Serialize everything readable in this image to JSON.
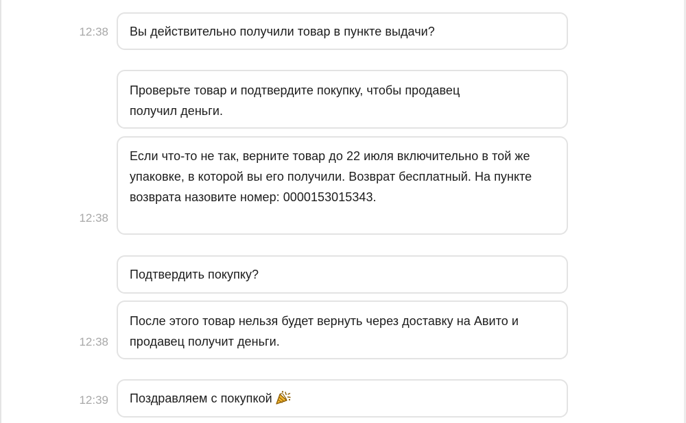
{
  "chat": {
    "messages": [
      {
        "time": "12:38",
        "text": "Вы действительно получили товар в пункте выдачи?"
      },
      {
        "time": "",
        "text": "Проверьте товар и подтвердите покупку, чтобы продавец получил деньги."
      },
      {
        "time": "12:38",
        "text": "Если что-то не так, верните товар до 22 июля включительно в той же упаковке, в которой вы его получили. Возврат бесплатный. На пункте возврата назовите номер: 0000153015343."
      },
      {
        "time": "",
        "text": "Подтвердить покупку?"
      },
      {
        "time": "12:38",
        "text": "После этого товар нельзя будет вернуть через доставку на Авито и продавец получит деньги."
      },
      {
        "time": "12:39",
        "text": "Поздравляем с покупкой",
        "icon": "party-popper-icon"
      }
    ]
  }
}
